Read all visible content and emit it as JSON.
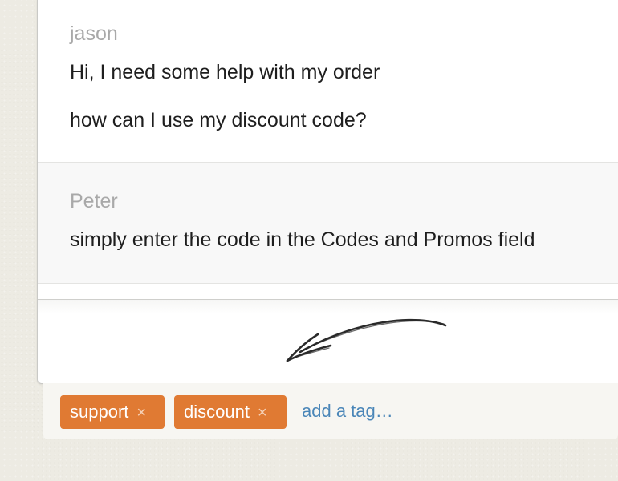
{
  "conversation": {
    "messages": [
      {
        "author": "jason",
        "lines": [
          "Hi, I need some help with my order",
          "how can I use my discount code?"
        ]
      },
      {
        "author": "Peter",
        "lines": [
          "simply enter the code in the Codes and Promos field"
        ]
      }
    ]
  },
  "composer": {
    "icon": "hand-drawn-arrow-icon"
  },
  "tags": {
    "items": [
      {
        "label": "support",
        "remove": "×"
      },
      {
        "label": "discount",
        "remove": "×"
      }
    ],
    "add_placeholder": "add a tag…"
  },
  "colors": {
    "tag_background": "#e07a33",
    "link": "#4a86b8",
    "author_text": "#a9a9a9",
    "message_text": "#1e1e1e"
  }
}
